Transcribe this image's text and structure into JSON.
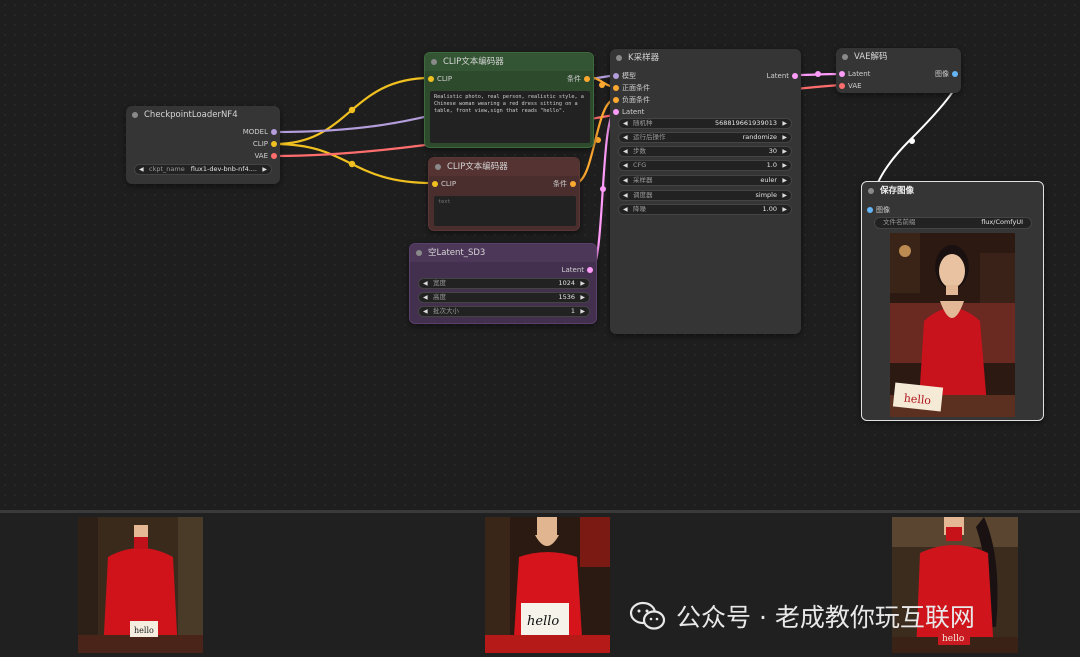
{
  "colors": {
    "clip_wire": "#f0c020",
    "model_wire": "#b39ddb",
    "vae_wire": "#ff6e6e",
    "cond_wire": "#ffa931",
    "latent_wire": "#ff9cf9",
    "image_wire": "#ffffff",
    "positive_node": "#2d4a2d",
    "negative_node": "#4a2d2d",
    "latent_node": "#43304f"
  },
  "checkpoint_loader": {
    "title": "CheckpointLoaderNF4",
    "outputs": [
      "MODEL",
      "CLIP",
      "VAE"
    ],
    "ckpt_label": "ckpt_name",
    "ckpt_value": "flux1-dev-bnb-nf4...."
  },
  "clip_positive": {
    "title": "CLIP文本编码器",
    "input": "CLIP",
    "output": "条件",
    "text": "Realistic photo, real person, realistic style, a Chinese woman wearing a red dress sitting on a table, front view,sign that reads \"hello\"."
  },
  "clip_negative": {
    "title": "CLIP文本编码器",
    "input": "CLIP",
    "output": "条件",
    "text": "text"
  },
  "empty_latent": {
    "title": "空Latent_SD3",
    "output": "Latent",
    "widgets": [
      {
        "label": "宽度",
        "value": "1024"
      },
      {
        "label": "高度",
        "value": "1536"
      },
      {
        "label": "批次大小",
        "value": "1"
      }
    ]
  },
  "ksampler": {
    "title": "K采样器",
    "inputs": [
      "模型",
      "正面条件",
      "负面条件",
      "Latent"
    ],
    "output": "Latent",
    "widgets": [
      {
        "label": "随机种",
        "value": "568819661939013"
      },
      {
        "label": "运行后操作",
        "value": "randomize"
      },
      {
        "label": "步数",
        "value": "30"
      },
      {
        "label": "CFG",
        "value": "1.0"
      },
      {
        "label": "采样器",
        "value": "euler"
      },
      {
        "label": "调度器",
        "value": "simple"
      },
      {
        "label": "降噪",
        "value": "1.00"
      }
    ]
  },
  "vae_decode": {
    "title": "VAE解码",
    "inputs": [
      "Latent",
      "VAE"
    ],
    "output": "图像"
  },
  "save_image": {
    "title": "保存图像",
    "input": "图像",
    "prefix_label": "文件名前缀",
    "prefix_value": "flux/ComfyUI",
    "sign_text": "hello"
  },
  "thumbnails": [
    {
      "sign_text": "hello"
    },
    {
      "sign_text": "hello"
    },
    {
      "sign_text": "hello"
    }
  ],
  "watermark": {
    "icon": "wechat-icon",
    "text": "公众号 · 老成教你玩互联网"
  }
}
